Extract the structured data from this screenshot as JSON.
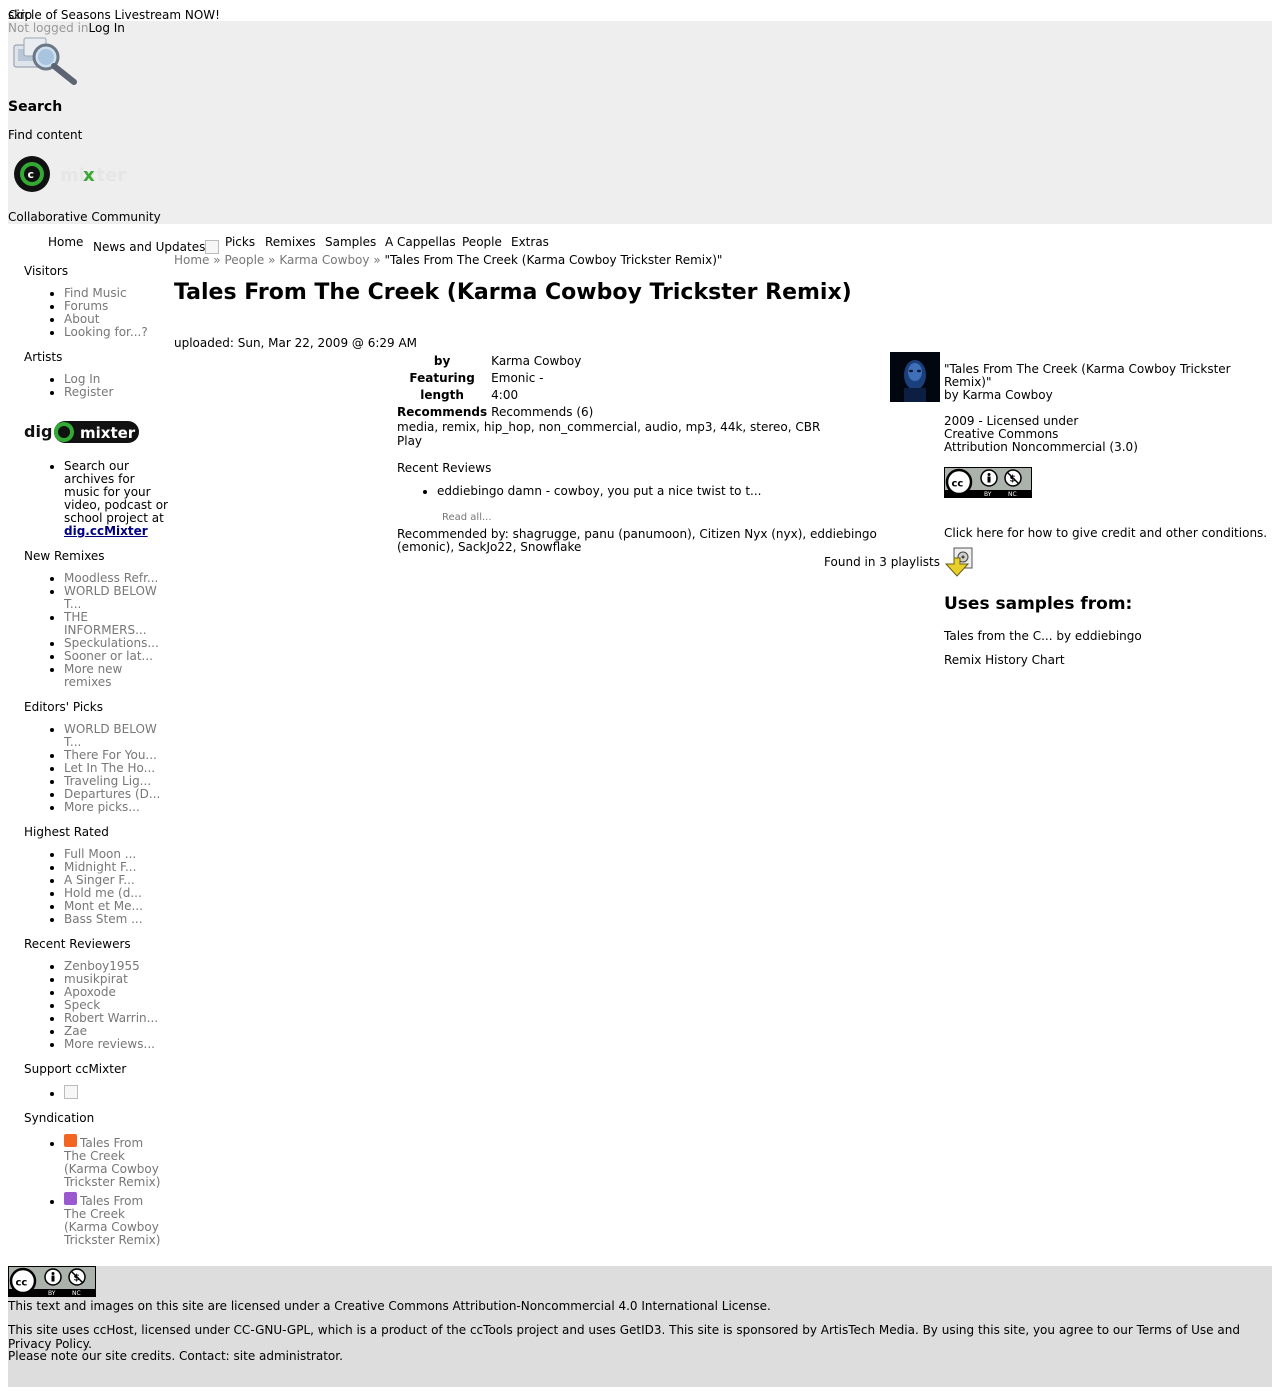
{
  "top_banner": {
    "skip": "skip",
    "announcement": "Circle of Seasons Livestream NOW!"
  },
  "header": {
    "not_logged_in": "Not logged in",
    "login": "Log In",
    "search_title": "Search",
    "find_content": "Find content",
    "tagline": "Collaborative Community",
    "logo_text": "mixter"
  },
  "nav": {
    "items": [
      "Home",
      "News and Updates",
      "Picks",
      "Remixes",
      "Samples",
      "A Cappellas",
      "People",
      "Extras"
    ]
  },
  "sidebar": {
    "visitors": {
      "title": "Visitors",
      "items": [
        "Find Music",
        "Forums",
        "About",
        "Looking for...?"
      ]
    },
    "artists": {
      "title": "Artists",
      "items": [
        "Log In",
        "Register"
      ]
    },
    "dig": {
      "logo_left": "dig",
      "logo_right": "mixter",
      "text": "Search our archives for music for your video, podcast or school project at ",
      "link": "dig.ccMixter"
    },
    "new_remixes": {
      "title": "New Remixes",
      "items": [
        "Moodless Refr...",
        "WORLD BELOW T...",
        "THE INFORMERS...",
        "Speckulations...",
        "Sooner or lat...",
        "More new remixes"
      ]
    },
    "editors_picks": {
      "title": "Editors' Picks",
      "items": [
        "WORLD BELOW T...",
        "There For You...",
        "Let In The Ho...",
        "Traveling Lig...",
        "Departures (D...",
        "More picks..."
      ]
    },
    "highest_rated": {
      "title": "Highest Rated",
      "items": [
        "Full Moon ...",
        "Midnight F...",
        "A Singer F...",
        "Hold me (d...",
        "Mont et Me...",
        "Bass Stem ..."
      ]
    },
    "recent_reviewers": {
      "title": "Recent Reviewers",
      "items": [
        "Zenboy1955",
        "musikpirat",
        "Apoxode",
        "Speck",
        "Robert Warrin...",
        "Zae",
        "More reviews..."
      ]
    },
    "support": {
      "title": "Support ccMixter"
    },
    "syndication": {
      "title": "Syndication",
      "items": [
        "Tales From The Creek (Karma Cowboy Trickster Remix)",
        "Tales From The Creek (Karma Cowboy Trickster Remix)"
      ]
    }
  },
  "breadcrumb": {
    "home": "Home",
    "sep": "»",
    "people": "People",
    "artist": "Karma Cowboy",
    "current": "\"Tales From The Creek (Karma Cowboy Trickster Remix)\""
  },
  "upload": {
    "title": "Tales From The Creek (Karma Cowboy Trickster Remix)",
    "uploaded": "uploaded: Sun, Mar 22, 2009 @ 6:29 AM",
    "fields": [
      {
        "key": "by",
        "value": "Karma Cowboy"
      },
      {
        "key": "Featuring",
        "value": "Emonic -"
      },
      {
        "key": "length",
        "value": "4:00"
      },
      {
        "key": "Recommends",
        "value": "Recommends (6)"
      }
    ],
    "tags": "media, remix, hip_hop, non_commercial, audio, mp3, 44k, stereo, CBR",
    "play": "Play",
    "recent_reviews_title": "Recent Reviews",
    "reviews": [
      "eddiebingo damn - cowboy, you put a nice twist to t..."
    ],
    "read_all": "Read all...",
    "recommended_by": "Recommended by: shagrugge, panu (panumoon), Citizen Nyx (nyx), eddiebingo (emonic), SackJo22, Snowflake",
    "playlists": "Found in 3 playlists"
  },
  "license_box": {
    "title_line": "\"Tales From The Creek (Karma Cowboy Trickster Remix)\"",
    "by_line": "by Karma Cowboy",
    "license_line1": "2009 - Licensed under",
    "license_line2": "Creative Commons",
    "license_line3": "Attribution Noncommercial (3.0)",
    "credit": "Click here for how to give credit and other conditions.",
    "uses_title": "Uses samples from:",
    "uses_item": "Tales from the C... by eddiebingo",
    "history": "Remix History Chart"
  },
  "footer": {
    "line1": "This text and images on this site are licensed under a Creative Commons Attribution-Noncommercial 4.0 International License.",
    "line2": "This site uses ccHost, licensed under CC-GNU-GPL, which is a product of the ccTools project and uses GetID3. This site is sponsored by ArtisTech Media. By using this site, you agree to our Terms of Use and Privacy Policy.",
    "line3": "Please note our site credits. Contact: site administrator."
  },
  "colors": {
    "header_bg": "#eeeeee",
    "footer_bg": "#dddddd",
    "muted_link": "#777777",
    "dig_link": "#000080"
  }
}
